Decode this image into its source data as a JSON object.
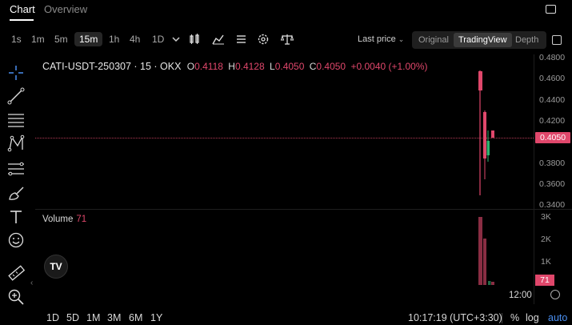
{
  "tabs": [
    {
      "label": "Chart",
      "active": true
    },
    {
      "label": "Overview",
      "active": false
    }
  ],
  "toolbar": {
    "intervals": [
      "1s",
      "1m",
      "5m",
      "15m",
      "1h",
      "4h",
      "1D"
    ],
    "active_interval": "15m",
    "last_price_label": "Last price",
    "views": [
      "Original",
      "TradingView",
      "Depth"
    ],
    "active_view": "TradingView",
    "icons": [
      "chevron-down-icon",
      "candles-icon",
      "indicators-icon",
      "list-icon",
      "settings-icon",
      "scale-icon",
      "fullscreen-icon"
    ]
  },
  "left_tools": [
    "crosshair-icon",
    "trendline-icon",
    "horizontal-lines-icon",
    "pattern-icon",
    "fib-icon",
    "brush-icon",
    "text-icon",
    "emoji-icon",
    "ruler-icon",
    "zoom-in-icon"
  ],
  "legend": {
    "symbol": "CATI-USDT-250307 · 15 · OKX",
    "o_key": "O",
    "o": "0.4118",
    "h_key": "H",
    "h": "0.4128",
    "l_key": "L",
    "l": "0.4050",
    "c_key": "C",
    "c": "0.4050",
    "change": "+0.0040 (+1.00%)"
  },
  "price_axis": [
    "0.4800",
    "0.4600",
    "0.4400",
    "0.4200",
    "0.3800",
    "0.3600",
    "0.3400"
  ],
  "current_price": "0.4050",
  "volume": {
    "label": "Volume",
    "value": "71",
    "axis": [
      "3K",
      "2K",
      "1K"
    ]
  },
  "time_axis_label": "12:00",
  "logo": "TV",
  "bottom": {
    "ranges": [
      "1D",
      "5D",
      "1M",
      "3M",
      "6M",
      "1Y"
    ],
    "clock": "10:17:19 (UTC+3:30)",
    "percent": "%",
    "log": "log",
    "auto": "auto"
  },
  "colors": {
    "up": "#2db36f",
    "down": "#e0476b",
    "accent": "#4a8ff0"
  }
}
